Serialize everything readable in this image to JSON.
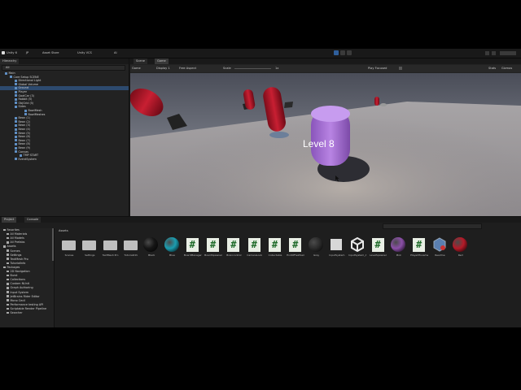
{
  "toolbar": {
    "app_title": "Unity 6",
    "account": "JP",
    "asset_store": "Asset Store",
    "vcs": "Unity VCS",
    "ai": "AI"
  },
  "hierarchy": {
    "tab": "Hierarchy",
    "search_placeholder": "All",
    "items": [
      {
        "label": "Main"
      },
      {
        "label": "Core Setup SCENE"
      },
      {
        "label": "Directional Light"
      },
      {
        "label": "Global Volume"
      },
      {
        "label": "Ground"
      },
      {
        "label": "Player"
      },
      {
        "label": "GoalCar (3)"
      },
      {
        "label": "Rabbit (5)"
      },
      {
        "label": "ObjGrid (5)"
      },
      {
        "label": "Sides"
      },
      {
        "label": "BowlMesh"
      },
      {
        "label": "BowlMeshes"
      },
      {
        "label": "Bean (1)"
      },
      {
        "label": "Bean (2)"
      },
      {
        "label": "Bean (3)"
      },
      {
        "label": "Bean (4)"
      },
      {
        "label": "Bean (5)"
      },
      {
        "label": "Bean (6)"
      },
      {
        "label": "Bean (7)"
      },
      {
        "label": "Bean (8)"
      },
      {
        "label": "Bean (9)"
      },
      {
        "label": "Canvas"
      },
      {
        "label": "TMP START"
      },
      {
        "label": "EventSystem"
      }
    ]
  },
  "game_panel": {
    "tabs": [
      "Scene",
      "Game"
    ],
    "display": "Game",
    "display_sel": "Display 1",
    "aspect": "Free Aspect",
    "scale_label": "Scale",
    "scale_value": "1x",
    "play_focused": "Play Focused",
    "stats": "Stats",
    "gizmos": "Gizmos",
    "level_text": "Level 8"
  },
  "project": {
    "tabs": [
      "Project",
      "Console"
    ],
    "breadcrumb": "Assets",
    "tree": [
      {
        "label": "Favorites"
      },
      {
        "label": "All Materials"
      },
      {
        "label": "All Models"
      },
      {
        "label": "All Prefabs"
      },
      {
        "label": "Assets"
      },
      {
        "label": "Scenes"
      },
      {
        "label": "Settings"
      },
      {
        "label": "TextMesh Pro"
      },
      {
        "label": "TutorialInfo"
      },
      {
        "label": "Packages"
      },
      {
        "label": "2D Navigation"
      },
      {
        "label": "Burst"
      },
      {
        "label": "Collections"
      },
      {
        "label": "Custom NUnit"
      },
      {
        "label": "Graph Authoring"
      },
      {
        "label": "Input System"
      },
      {
        "label": "JetBrains Rider Editor"
      },
      {
        "label": "Mono Cecil"
      },
      {
        "label": "Performance testing API"
      },
      {
        "label": "Scriptable Render Pipeline"
      },
      {
        "label": "Searcher"
      }
    ],
    "assets": [
      {
        "label": "Scenes",
        "kind": "folder"
      },
      {
        "label": "Settings",
        "kind": "folder"
      },
      {
        "label": "TextMesh Pro",
        "kind": "folder"
      },
      {
        "label": "TutorialInfo",
        "kind": "folder"
      },
      {
        "label": "Black",
        "kind": "sphere",
        "color": "#161616"
      },
      {
        "label": "Blue",
        "kind": "sphere",
        "color": "#1b9db0"
      },
      {
        "label": "BoardManager",
        "kind": "script"
      },
      {
        "label": "BoardSpawner",
        "kind": "script"
      },
      {
        "label": "Braincontrol",
        "kind": "script"
      },
      {
        "label": "CameraLook",
        "kind": "script"
      },
      {
        "label": "Collectable",
        "kind": "script"
      },
      {
        "label": "EndOfFieldSample",
        "kind": "script"
      },
      {
        "label": "Grey",
        "kind": "sphere",
        "color": "#2c2c2c"
      },
      {
        "label": "InputSystem",
        "kind": "input"
      },
      {
        "label": "InputSystem_Actions",
        "kind": "unity"
      },
      {
        "label": "LevelSpawner",
        "kind": "script"
      },
      {
        "label": "Pink",
        "kind": "sphere",
        "color": "#8b4fa8"
      },
      {
        "label": "PlayerMovement",
        "kind": "script"
      },
      {
        "label": "Readme",
        "kind": "readme"
      },
      {
        "label": "Red",
        "kind": "sphere",
        "color": "#b51a28"
      }
    ]
  }
}
